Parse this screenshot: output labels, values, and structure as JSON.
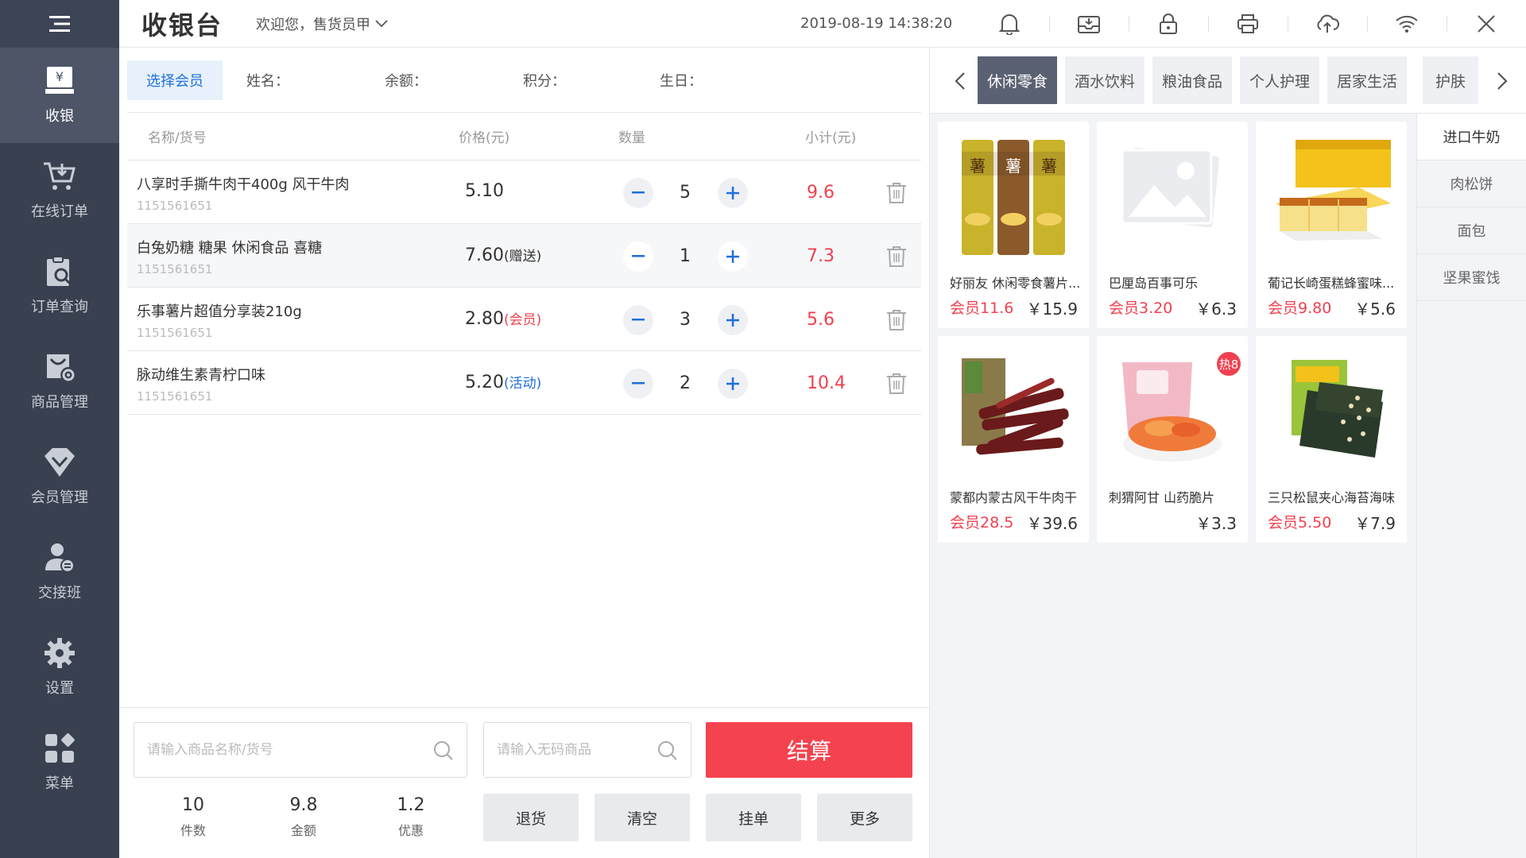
{
  "app": {
    "title": "收银台",
    "welcome": "欢迎您，售货员甲",
    "datetime": "2019-08-19 14:38:20"
  },
  "sidebar": {
    "items": [
      {
        "label": "收银",
        "icon": "cashier-icon"
      },
      {
        "label": "在线订单",
        "icon": "cart-icon"
      },
      {
        "label": "订单查询",
        "icon": "order-search-icon"
      },
      {
        "label": "商品管理",
        "icon": "goods-manage-icon"
      },
      {
        "label": "会员管理",
        "icon": "member-diamond-icon"
      },
      {
        "label": "交接班",
        "icon": "handover-icon"
      },
      {
        "label": "设置",
        "icon": "gear-icon"
      },
      {
        "label": "菜单",
        "icon": "apps-icon"
      }
    ]
  },
  "top_icons": [
    "bell-icon",
    "inbox-icon",
    "lock-icon",
    "printer-icon",
    "cloud-icon",
    "wifi-icon",
    "close-icon"
  ],
  "member": {
    "select_label": "选择会员",
    "name_label": "姓名：",
    "balance_label": "余额：",
    "points_label": "积分：",
    "birthday_label": "生日："
  },
  "cart": {
    "headers": {
      "name": "名称/货号",
      "price": "价格(元)",
      "qty": "数量",
      "subtotal": "小计(元)"
    },
    "rows": [
      {
        "name": "八享时手撕牛肉干400g 风干牛肉",
        "code": "1151561651",
        "price": "5.10",
        "tag": "",
        "qty": "5",
        "subtotal": "9.6"
      },
      {
        "name": "白兔奶糖 糖果 休闲食品 喜糖",
        "code": "1151561651",
        "price": "7.60",
        "tag": "(赠送)",
        "qty": "1",
        "subtotal": "7.3"
      },
      {
        "name": "乐事薯片超值分享装210g",
        "code": "1151561651",
        "price": "2.80",
        "tag": "(会员)",
        "qty": "3",
        "subtotal": "5.6"
      },
      {
        "name": "脉动维生素青柠口味",
        "code": "1151561651",
        "price": "5.20",
        "tag": "(活动)",
        "qty": "2",
        "subtotal": "10.4"
      }
    ]
  },
  "search": {
    "product_placeholder": "请输入商品名称/货号",
    "nocode_placeholder": "请输入无码商品"
  },
  "checkout_label": "结算",
  "stats": [
    {
      "value": "10",
      "label": "件数"
    },
    {
      "value": "9.8",
      "label": "金额"
    },
    {
      "value": "1.2",
      "label": "优惠"
    }
  ],
  "actions": {
    "refund": "退货",
    "clear": "清空",
    "hold": "挂单",
    "more": "更多"
  },
  "categories": [
    "休闲零食",
    "酒水饮料",
    "粮油食品",
    "个人护理",
    "居家生活",
    "护肤"
  ],
  "sub_categories": [
    "进口牛奶",
    "肉松饼",
    "面包",
    "坚果蜜饯"
  ],
  "products": [
    {
      "name": "好丽友 休闲零食薯片...",
      "member_price": "会员11.6",
      "price": "￥15.9"
    },
    {
      "name": "巴厘岛百事可乐",
      "member_price": "会员3.20",
      "price": "￥6.3"
    },
    {
      "name": "葡记长崎蛋糕蜂蜜味...",
      "member_price": "会员9.80",
      "price": "￥5.6"
    },
    {
      "name": "蒙都内蒙古风干牛肉干",
      "member_price": "会员28.5",
      "price": "￥39.6"
    },
    {
      "name": "刺猬阿甘 山药脆片",
      "member_price": "",
      "price": "￥3.3",
      "badge": "热8"
    },
    {
      "name": "三只松鼠夹心海苔海味",
      "member_price": "会员5.50",
      "price": "￥7.9"
    }
  ],
  "colors": {
    "sidebar": "#39404f",
    "accent": "#1f6fd8",
    "danger": "#f5424f"
  }
}
